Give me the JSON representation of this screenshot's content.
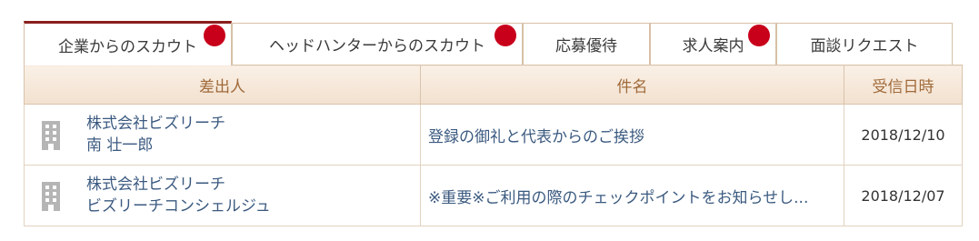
{
  "tabs": [
    {
      "label": "企業からのスカウト",
      "active": true,
      "has_badge": true
    },
    {
      "label": "ヘッドハンターからのスカウト",
      "active": false,
      "has_badge": true
    },
    {
      "label": "応募優待",
      "active": false,
      "has_badge": false
    },
    {
      "label": "求人案内",
      "active": false,
      "has_badge": true
    },
    {
      "label": "面談リクエスト",
      "active": false,
      "has_badge": false
    }
  ],
  "table": {
    "headers": {
      "sender": "差出人",
      "subject": "件名",
      "date": "受信日時"
    },
    "rows": [
      {
        "company": "株式会社ビズリーチ",
        "person": "南 壮一郎",
        "subject": "登録の御礼と代表からのご挨拶",
        "date": "2018/12/10"
      },
      {
        "company": "株式会社ビズリーチ",
        "person": "ビズリーチコンシェルジュ",
        "subject": "※重要※ご利用の際のチェックポイントをお知らせし...",
        "date": "2018/12/07"
      }
    ]
  },
  "colors": {
    "badge": "#c8001a",
    "active_tab_top": "#8a1e1e",
    "link_text": "#3b5a80",
    "header_text": "#a06a3a"
  },
  "icons": {
    "sender_icon": "building-icon",
    "badge": "notification-dot"
  }
}
